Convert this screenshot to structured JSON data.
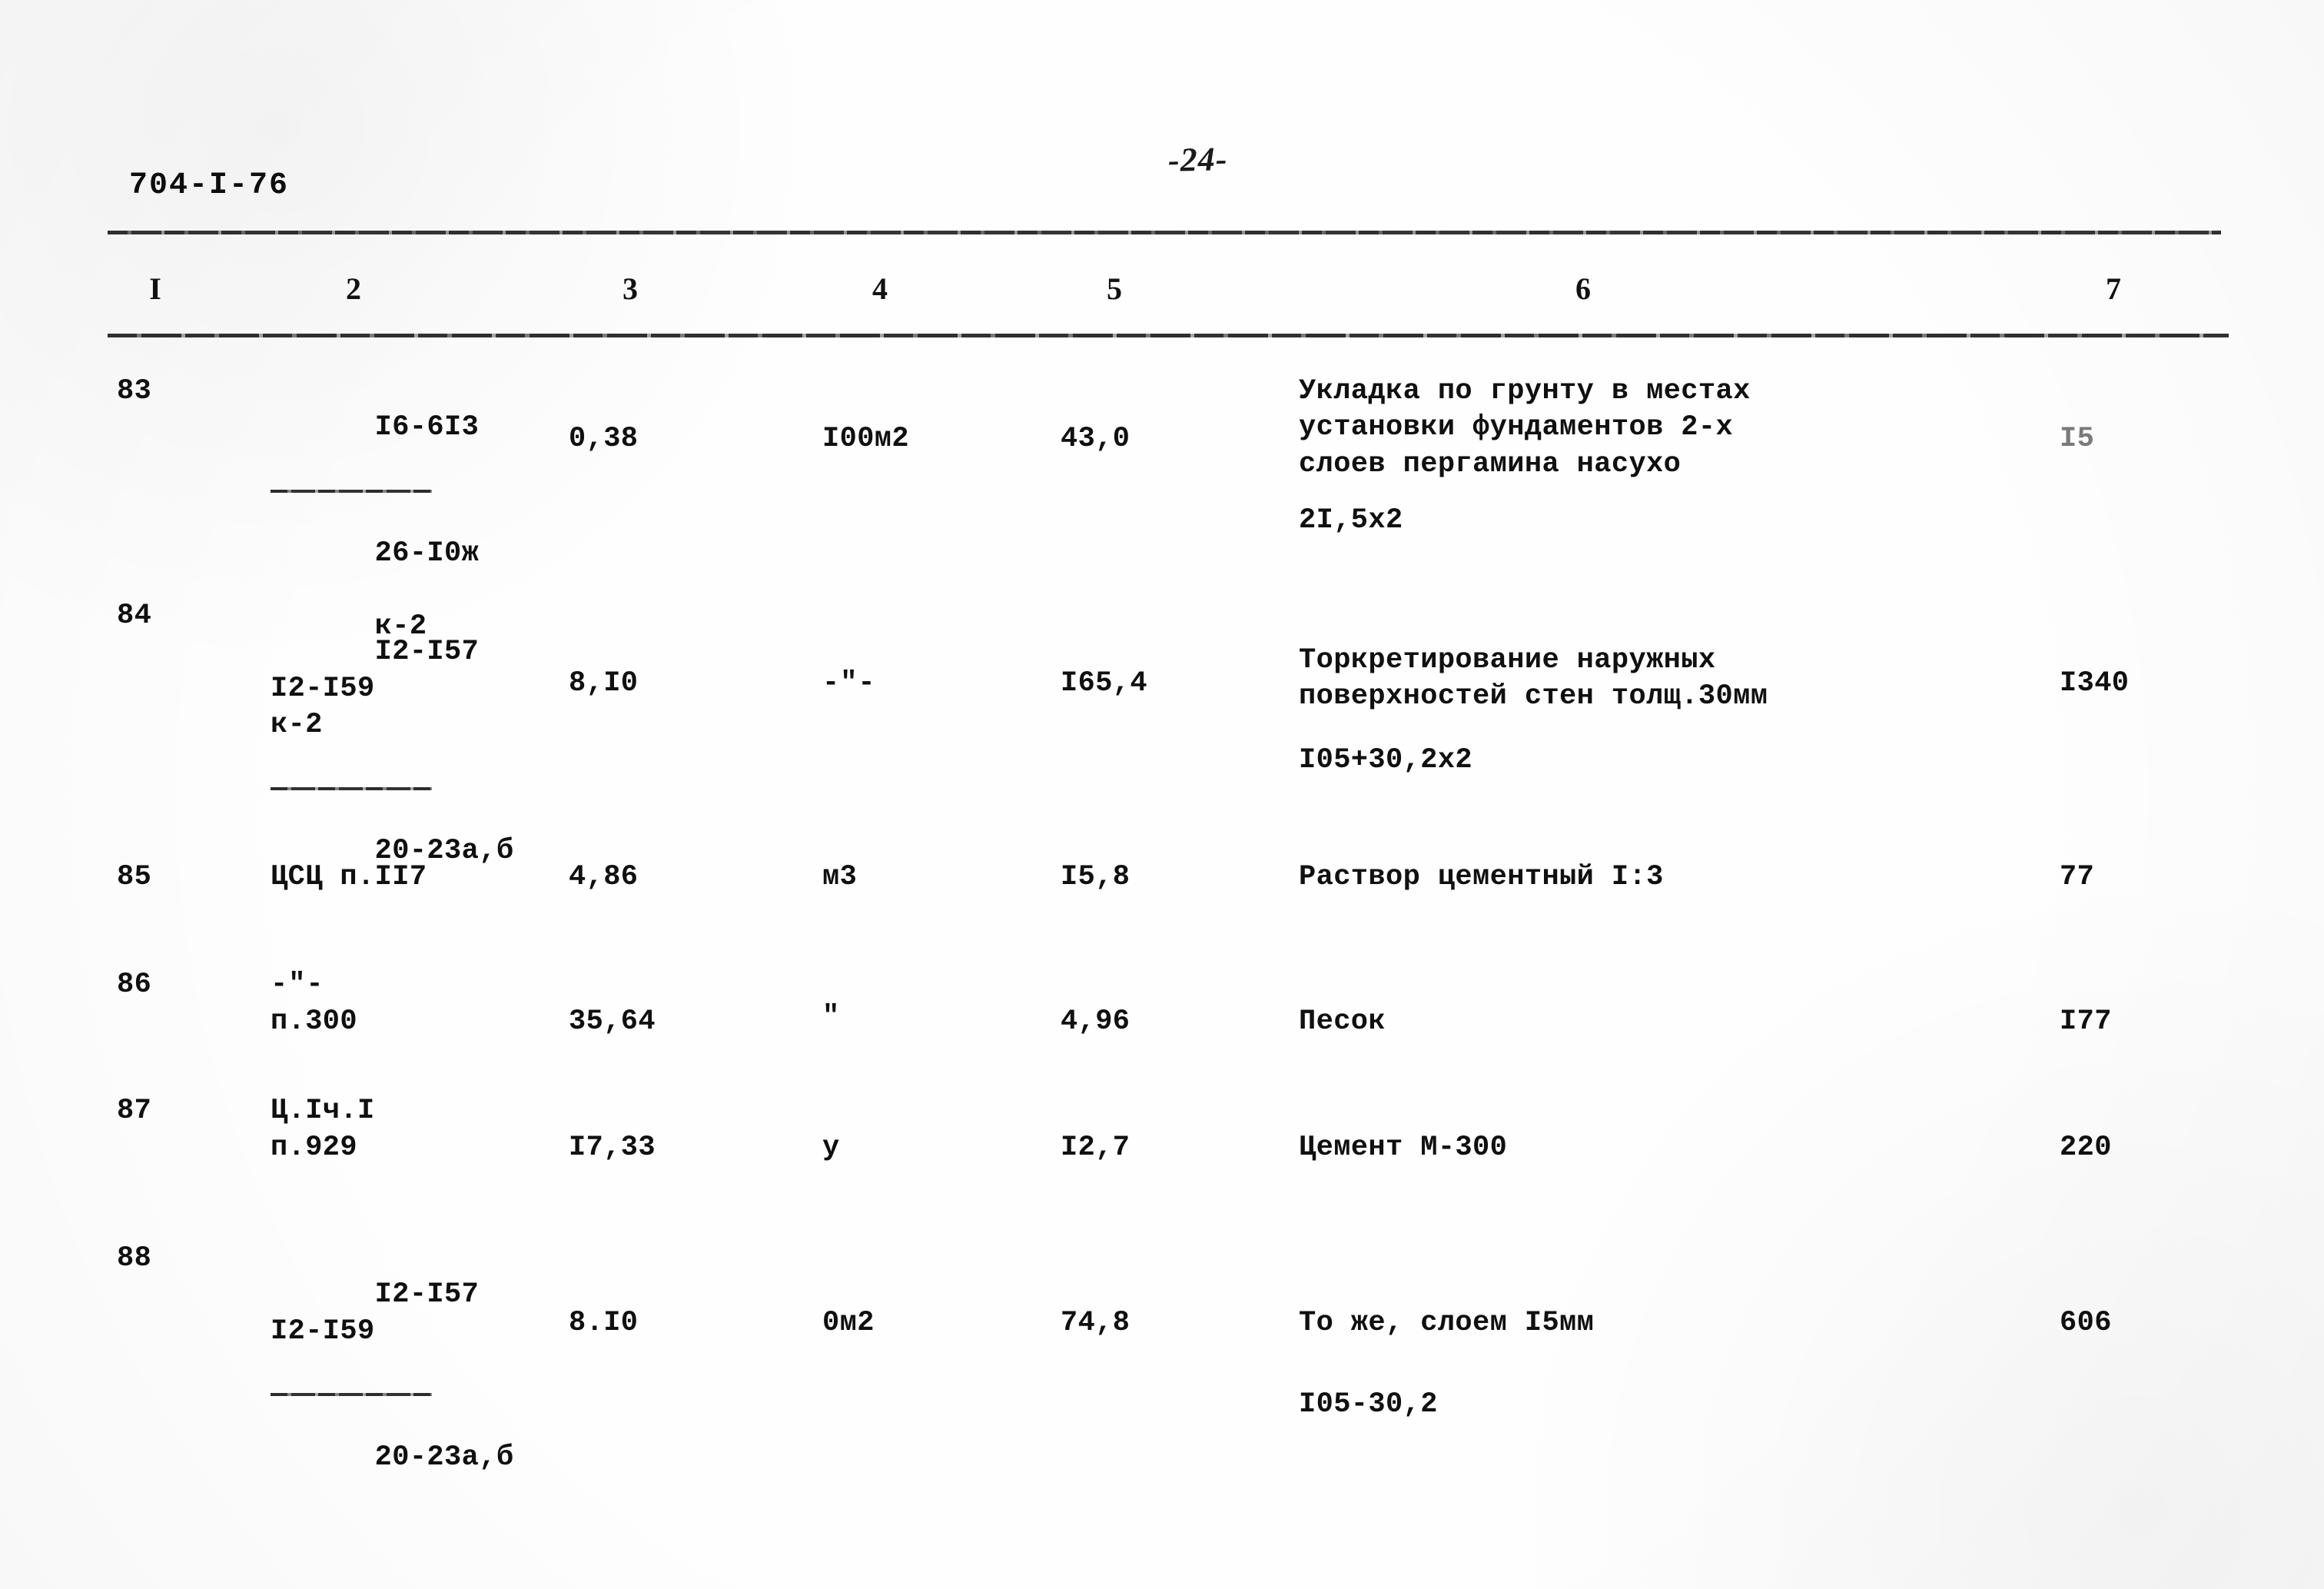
{
  "document": {
    "code": "704-I-76",
    "page_marker": "-24-"
  },
  "table": {
    "column_headers": [
      "I",
      "2",
      "3",
      "4",
      "5",
      "6",
      "7"
    ],
    "rows": [
      {
        "num": "83",
        "ref_above": "I6-6I3",
        "ref_below_1": "26-I0ж",
        "ref_below_2": "к-2",
        "has_fraction_bar": true,
        "col3": "0,38",
        "col4": "I00м2",
        "col5": "43,0",
        "description": "Укладка по грунту в местах\nустановки фундаментов 2-х\nслоев пергамина насухо",
        "formula": "2I,5х2",
        "col7": "I5"
      },
      {
        "num": "84",
        "ref_above": "I2-I57\nI2-I59\nк-2",
        "ref_below_1": "20-23а,б",
        "ref_below_2": "",
        "has_fraction_bar": true,
        "col3": "8,I0",
        "col4": "-\"-",
        "col5": "I65,4",
        "description": "Торкретирование наружных\nповерхностей стен толщ.30мм",
        "formula": "I05+30,2х2",
        "col7": "I340"
      },
      {
        "num": "85",
        "ref_above": "ЦСЦ п.II7",
        "ref_below_1": "",
        "ref_below_2": "",
        "has_fraction_bar": false,
        "col3": "4,86",
        "col4": "м3",
        "col5": "I5,8",
        "description": "Раствор цементный I:3",
        "formula": "",
        "col7": "77"
      },
      {
        "num": "86",
        "ref_above": "-\"-",
        "ref_below_1": "п.300",
        "ref_below_2": "",
        "has_fraction_bar": false,
        "col3": "35,64",
        "col4": "\"",
        "col5": "4,96",
        "description": "Песок",
        "formula": "",
        "col7": "I77"
      },
      {
        "num": "87",
        "ref_above": "Ц.Iч.I",
        "ref_below_1": "п.929",
        "ref_below_2": "",
        "has_fraction_bar": false,
        "col3": "I7,33",
        "col4": "у",
        "col5": "I2,7",
        "description": "Цемент М-300",
        "formula": "",
        "col7": "220"
      },
      {
        "num": "88",
        "ref_above": "I2-I57\nI2-I59",
        "ref_below_1": "20-23а,б",
        "ref_below_2": "",
        "has_fraction_bar": true,
        "col3": "8.I0",
        "col4": "0м2",
        "col5": "74,8",
        "description": "То же, слоем I5мм",
        "formula": "I05-30,2",
        "col7": "606"
      }
    ]
  }
}
